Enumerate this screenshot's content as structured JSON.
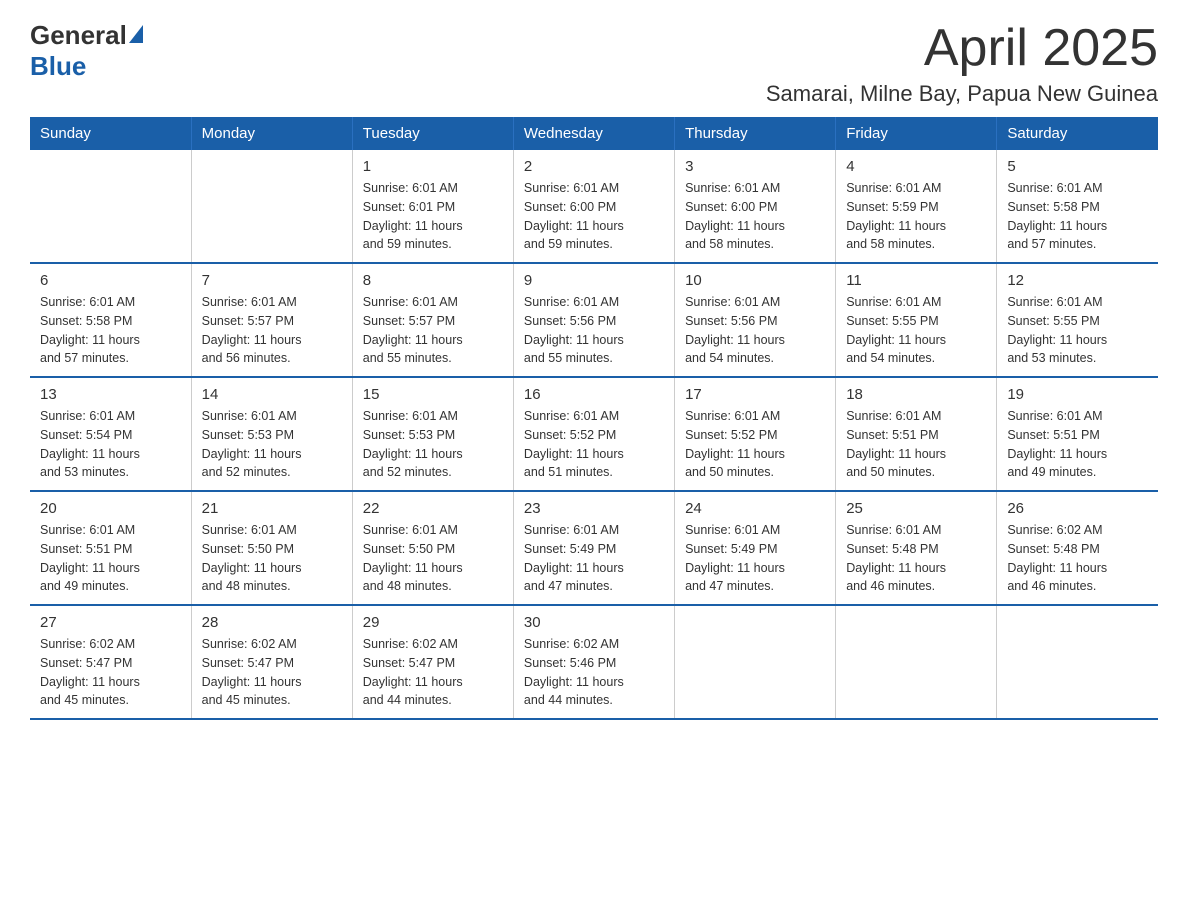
{
  "logo": {
    "general": "General",
    "blue": "Blue"
  },
  "header": {
    "title": "April 2025",
    "subtitle": "Samarai, Milne Bay, Papua New Guinea"
  },
  "calendar": {
    "days_of_week": [
      "Sunday",
      "Monday",
      "Tuesday",
      "Wednesday",
      "Thursday",
      "Friday",
      "Saturday"
    ],
    "weeks": [
      [
        {
          "day": "",
          "info": ""
        },
        {
          "day": "",
          "info": ""
        },
        {
          "day": "1",
          "info": "Sunrise: 6:01 AM\nSunset: 6:01 PM\nDaylight: 11 hours\nand 59 minutes."
        },
        {
          "day": "2",
          "info": "Sunrise: 6:01 AM\nSunset: 6:00 PM\nDaylight: 11 hours\nand 59 minutes."
        },
        {
          "day": "3",
          "info": "Sunrise: 6:01 AM\nSunset: 6:00 PM\nDaylight: 11 hours\nand 58 minutes."
        },
        {
          "day": "4",
          "info": "Sunrise: 6:01 AM\nSunset: 5:59 PM\nDaylight: 11 hours\nand 58 minutes."
        },
        {
          "day": "5",
          "info": "Sunrise: 6:01 AM\nSunset: 5:58 PM\nDaylight: 11 hours\nand 57 minutes."
        }
      ],
      [
        {
          "day": "6",
          "info": "Sunrise: 6:01 AM\nSunset: 5:58 PM\nDaylight: 11 hours\nand 57 minutes."
        },
        {
          "day": "7",
          "info": "Sunrise: 6:01 AM\nSunset: 5:57 PM\nDaylight: 11 hours\nand 56 minutes."
        },
        {
          "day": "8",
          "info": "Sunrise: 6:01 AM\nSunset: 5:57 PM\nDaylight: 11 hours\nand 55 minutes."
        },
        {
          "day": "9",
          "info": "Sunrise: 6:01 AM\nSunset: 5:56 PM\nDaylight: 11 hours\nand 55 minutes."
        },
        {
          "day": "10",
          "info": "Sunrise: 6:01 AM\nSunset: 5:56 PM\nDaylight: 11 hours\nand 54 minutes."
        },
        {
          "day": "11",
          "info": "Sunrise: 6:01 AM\nSunset: 5:55 PM\nDaylight: 11 hours\nand 54 minutes."
        },
        {
          "day": "12",
          "info": "Sunrise: 6:01 AM\nSunset: 5:55 PM\nDaylight: 11 hours\nand 53 minutes."
        }
      ],
      [
        {
          "day": "13",
          "info": "Sunrise: 6:01 AM\nSunset: 5:54 PM\nDaylight: 11 hours\nand 53 minutes."
        },
        {
          "day": "14",
          "info": "Sunrise: 6:01 AM\nSunset: 5:53 PM\nDaylight: 11 hours\nand 52 minutes."
        },
        {
          "day": "15",
          "info": "Sunrise: 6:01 AM\nSunset: 5:53 PM\nDaylight: 11 hours\nand 52 minutes."
        },
        {
          "day": "16",
          "info": "Sunrise: 6:01 AM\nSunset: 5:52 PM\nDaylight: 11 hours\nand 51 minutes."
        },
        {
          "day": "17",
          "info": "Sunrise: 6:01 AM\nSunset: 5:52 PM\nDaylight: 11 hours\nand 50 minutes."
        },
        {
          "day": "18",
          "info": "Sunrise: 6:01 AM\nSunset: 5:51 PM\nDaylight: 11 hours\nand 50 minutes."
        },
        {
          "day": "19",
          "info": "Sunrise: 6:01 AM\nSunset: 5:51 PM\nDaylight: 11 hours\nand 49 minutes."
        }
      ],
      [
        {
          "day": "20",
          "info": "Sunrise: 6:01 AM\nSunset: 5:51 PM\nDaylight: 11 hours\nand 49 minutes."
        },
        {
          "day": "21",
          "info": "Sunrise: 6:01 AM\nSunset: 5:50 PM\nDaylight: 11 hours\nand 48 minutes."
        },
        {
          "day": "22",
          "info": "Sunrise: 6:01 AM\nSunset: 5:50 PM\nDaylight: 11 hours\nand 48 minutes."
        },
        {
          "day": "23",
          "info": "Sunrise: 6:01 AM\nSunset: 5:49 PM\nDaylight: 11 hours\nand 47 minutes."
        },
        {
          "day": "24",
          "info": "Sunrise: 6:01 AM\nSunset: 5:49 PM\nDaylight: 11 hours\nand 47 minutes."
        },
        {
          "day": "25",
          "info": "Sunrise: 6:01 AM\nSunset: 5:48 PM\nDaylight: 11 hours\nand 46 minutes."
        },
        {
          "day": "26",
          "info": "Sunrise: 6:02 AM\nSunset: 5:48 PM\nDaylight: 11 hours\nand 46 minutes."
        }
      ],
      [
        {
          "day": "27",
          "info": "Sunrise: 6:02 AM\nSunset: 5:47 PM\nDaylight: 11 hours\nand 45 minutes."
        },
        {
          "day": "28",
          "info": "Sunrise: 6:02 AM\nSunset: 5:47 PM\nDaylight: 11 hours\nand 45 minutes."
        },
        {
          "day": "29",
          "info": "Sunrise: 6:02 AM\nSunset: 5:47 PM\nDaylight: 11 hours\nand 44 minutes."
        },
        {
          "day": "30",
          "info": "Sunrise: 6:02 AM\nSunset: 5:46 PM\nDaylight: 11 hours\nand 44 minutes."
        },
        {
          "day": "",
          "info": ""
        },
        {
          "day": "",
          "info": ""
        },
        {
          "day": "",
          "info": ""
        }
      ]
    ]
  }
}
